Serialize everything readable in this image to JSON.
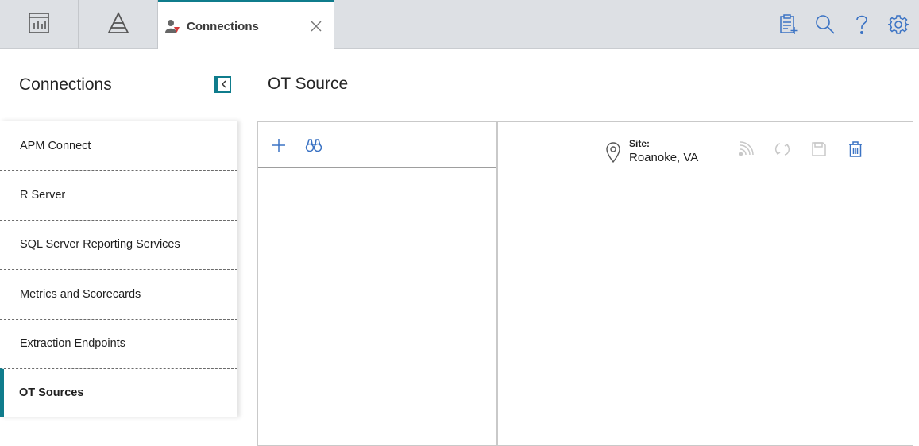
{
  "topbar": {
    "nav_tiles": [
      {
        "icon": "dashboard-chart-icon"
      },
      {
        "icon": "pyramid-icon"
      }
    ],
    "active_tab": {
      "label": "Connections",
      "icon": "user-connection-icon",
      "close_icon": "close-icon"
    },
    "actions": [
      {
        "icon": "checklist-add-icon"
      },
      {
        "icon": "search-icon"
      },
      {
        "icon": "help-icon"
      },
      {
        "icon": "gear-icon"
      }
    ]
  },
  "sidebar": {
    "title": "Connections",
    "collapse_icon": "chevron-left-icon",
    "items": [
      {
        "label": "APM Connect",
        "active": false
      },
      {
        "label": "R Server",
        "active": false
      },
      {
        "label": "SQL Server Reporting Services",
        "active": false
      },
      {
        "label": "Metrics and Scorecards",
        "active": false
      },
      {
        "label": "Extraction Endpoints",
        "active": false
      },
      {
        "label": "OT Sources",
        "active": true
      }
    ]
  },
  "main": {
    "title": "OT Source",
    "list_toolbar": [
      {
        "icon": "plus-icon"
      },
      {
        "icon": "binoculars-icon"
      }
    ],
    "detail": {
      "site_label": "Site:",
      "site_value": "Roanoke, VA",
      "actions": [
        {
          "icon": "feed-icon",
          "enabled": false
        },
        {
          "icon": "refresh-icon",
          "enabled": false
        },
        {
          "icon": "save-icon",
          "enabled": false
        },
        {
          "icon": "trash-icon",
          "enabled": true
        }
      ]
    }
  },
  "colors": {
    "accent": "#0f7c8c",
    "icon_blue": "#3b73c4",
    "icon_disabled": "#c8c8c8",
    "topbar_bg": "#dde0e4"
  }
}
